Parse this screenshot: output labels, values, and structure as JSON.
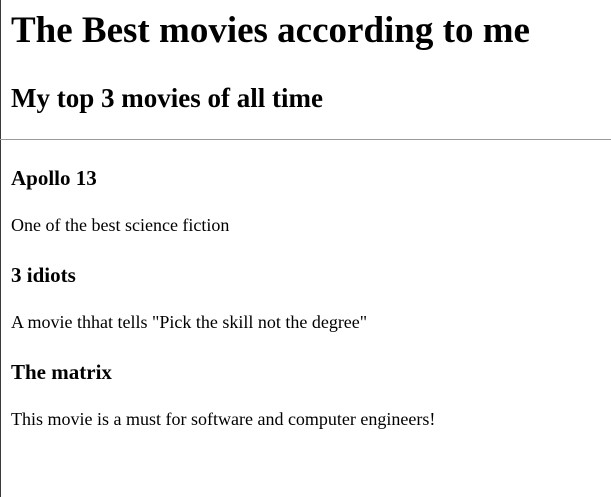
{
  "page": {
    "title": "The Best movies according to me",
    "subtitle": "My top 3 movies of all time"
  },
  "movies": [
    {
      "title": "Apollo 13",
      "description": "One of the best science fiction"
    },
    {
      "title": "3 idiots",
      "description": "A movie thhat tells \"Pick the skill not the degree\""
    },
    {
      "title": "The matrix",
      "description": "This movie is a must for software and computer engineers!"
    }
  ],
  "colors": {
    "background": "#ffffff",
    "text": "#000000",
    "divider": "#9a9a9a"
  }
}
